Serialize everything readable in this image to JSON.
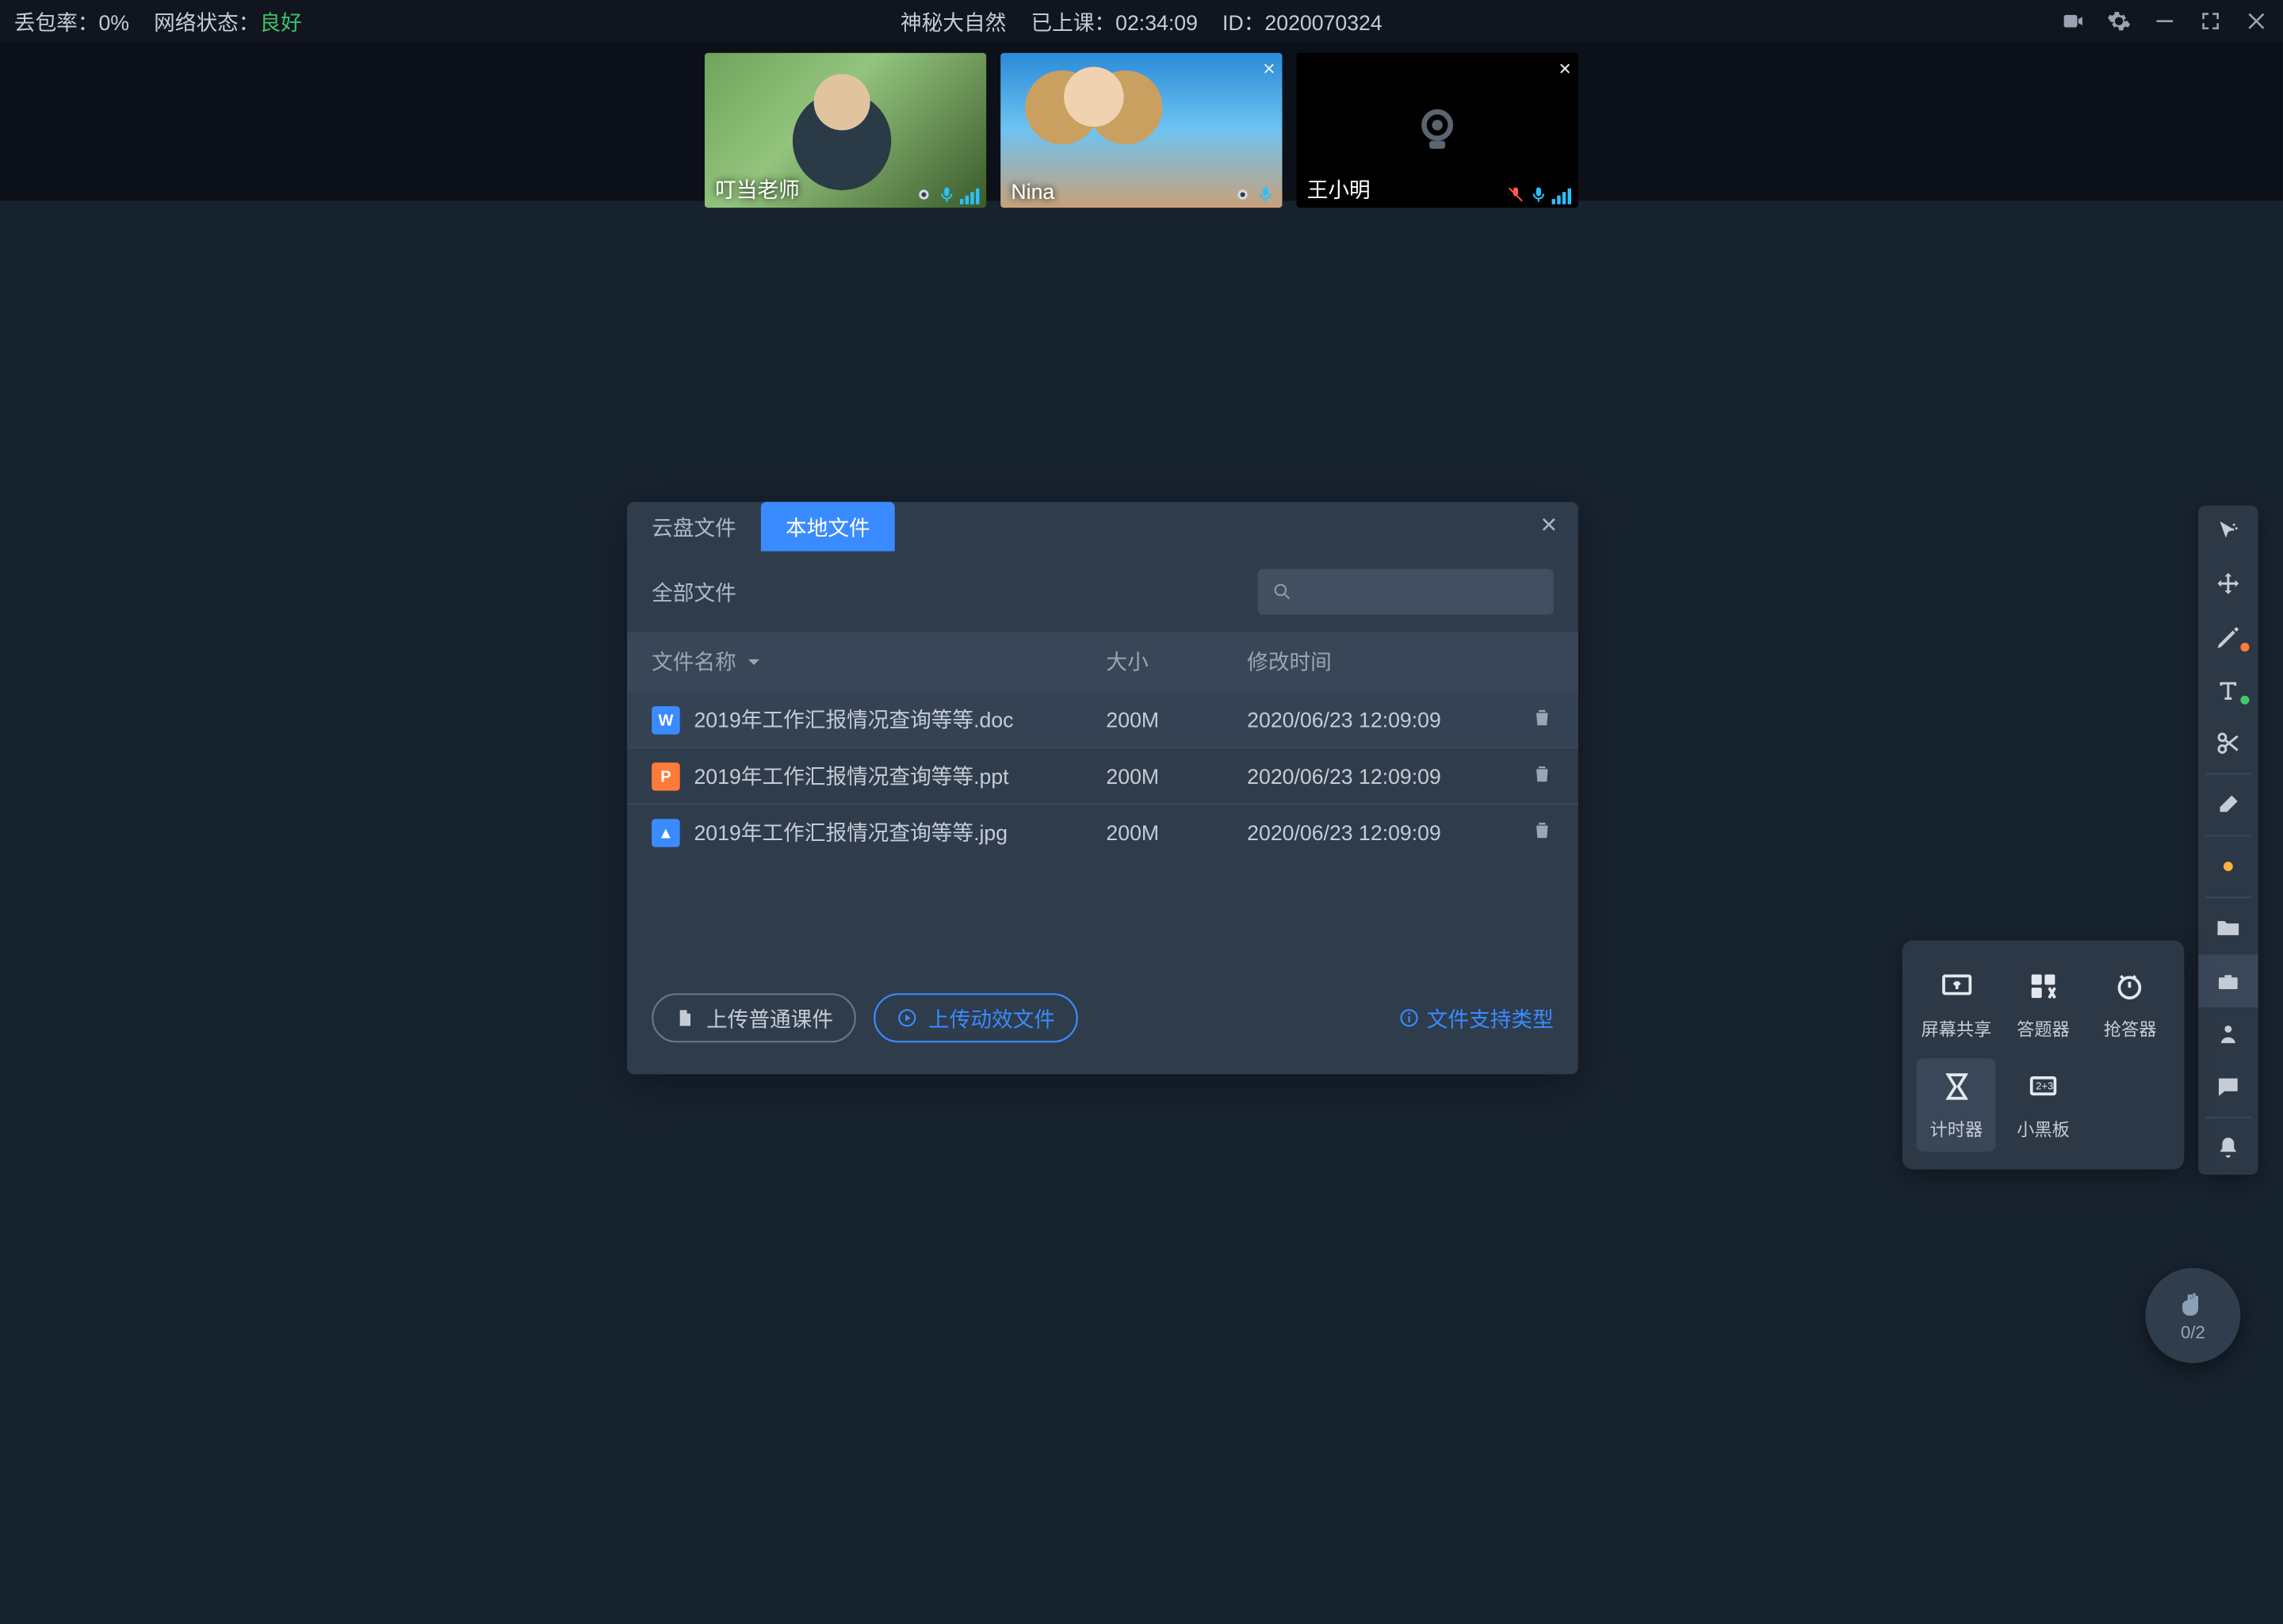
{
  "statusbar": {
    "packet_loss_label": "丢包率：",
    "packet_loss_value": "0%",
    "net_label": "网络状态：",
    "net_value": "良好",
    "title": "神秘大自然",
    "elapsed_label": "已上课：",
    "elapsed_value": "02:34:09",
    "id_label": "ID：",
    "id_value": "2020070324"
  },
  "participants": [
    {
      "name": "叮当老师",
      "camera": "on",
      "mic": "on",
      "closable": false,
      "thumbStyle": "fake1"
    },
    {
      "name": "Nina",
      "camera": "on",
      "mic": "on",
      "closable": true,
      "thumbStyle": "fake2"
    },
    {
      "name": "王小明",
      "camera": "off",
      "mic": "muted",
      "closable": true,
      "thumbStyle": "off"
    }
  ],
  "modal": {
    "tabs": {
      "cloud": "云盘文件",
      "local": "本地文件"
    },
    "all_files": "全部文件",
    "columns": {
      "name": "文件名称",
      "size": "大小",
      "mtime": "修改时间"
    },
    "files": [
      {
        "icon": "W",
        "iconClass": "fi-w",
        "name": "2019年工作汇报情况查询等等.doc",
        "size": "200M",
        "mtime": "2020/06/23 12:09:09"
      },
      {
        "icon": "P",
        "iconClass": "fi-p",
        "name": "2019年工作汇报情况查询等等.ppt",
        "size": "200M",
        "mtime": "2020/06/23 12:09:09"
      },
      {
        "icon": "▲",
        "iconClass": "fi-i",
        "name": "2019年工作汇报情况查询等等.jpg",
        "size": "200M",
        "mtime": "2020/06/23 12:09:09"
      }
    ],
    "btn_upload_normal": "上传普通课件",
    "btn_upload_anim": "上传动效文件",
    "link_support": "文件支持类型"
  },
  "tools_popup": {
    "screen_share": "屏幕共享",
    "quiz": "答题器",
    "buzzer": "抢答器",
    "timer": "计时器",
    "blackboard": "小黑板"
  },
  "hand": {
    "count": "0/2"
  }
}
